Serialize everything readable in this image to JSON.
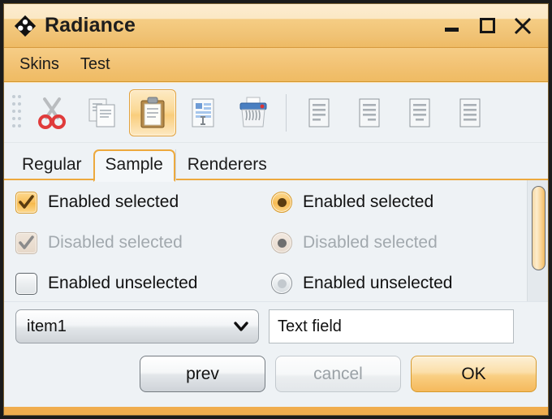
{
  "window": {
    "title": "Radiance",
    "app_icon": "diamond-logo-icon",
    "controls": [
      {
        "name": "minimize",
        "icon": "minimize-icon"
      },
      {
        "name": "maximize",
        "icon": "maximize-icon"
      },
      {
        "name": "close",
        "icon": "close-icon"
      }
    ]
  },
  "menubar": {
    "items": [
      {
        "label": "Skins"
      },
      {
        "label": "Test"
      }
    ]
  },
  "toolbar": {
    "grip_icon": "drag-grip-icon",
    "buttons": [
      {
        "name": "cut",
        "icon": "scissors-icon",
        "selected": false
      },
      {
        "name": "copy",
        "icon": "copy-documents-icon",
        "selected": false
      },
      {
        "name": "paste",
        "icon": "clipboard-icon",
        "selected": true
      },
      {
        "name": "paste-special",
        "icon": "document-edit-icon",
        "selected": false
      },
      {
        "name": "shred",
        "icon": "shredder-icon",
        "selected": false
      },
      {
        "name": "align-left",
        "icon": "align-left-icon",
        "selected": false
      },
      {
        "name": "align-right",
        "icon": "align-right-icon",
        "selected": false
      },
      {
        "name": "align-center",
        "icon": "align-center-icon",
        "selected": false
      },
      {
        "name": "align-justify",
        "icon": "align-justify-icon",
        "selected": false
      }
    ]
  },
  "tabs": [
    {
      "label": "Regular",
      "active": false
    },
    {
      "label": "Sample",
      "active": true
    },
    {
      "label": "Renderers",
      "active": false
    }
  ],
  "options": {
    "checkboxes": [
      {
        "label": "Enabled selected",
        "state": "on"
      },
      {
        "label": "Disabled selected",
        "state": "on-disabled"
      },
      {
        "label": "Enabled unselected",
        "state": "off"
      }
    ],
    "radios": [
      {
        "label": "Enabled selected",
        "state": "on"
      },
      {
        "label": "Disabled selected",
        "state": "on-disabled"
      },
      {
        "label": "Enabled unselected",
        "state": "off"
      }
    ]
  },
  "scrollbar": {
    "orientation": "vertical",
    "thumb_position_pct": 5
  },
  "fields": {
    "combobox": {
      "value": "item1",
      "arrow_icon": "chevron-down-icon"
    },
    "textfield": {
      "value": "Text field",
      "placeholder": "Text field"
    }
  },
  "buttons": [
    {
      "label": "prev",
      "state": "normal"
    },
    {
      "label": "cancel",
      "state": "disabled"
    },
    {
      "label": "OK",
      "state": "primary"
    }
  ],
  "colors": {
    "accent": "#f0ad4e",
    "accent_border": "#d99b2b",
    "titlebar_light": "#fbe8c4",
    "titlebar_dark": "#f0c274",
    "panel_bg": "#eef2f5",
    "tab_underline": "#eda93d"
  }
}
